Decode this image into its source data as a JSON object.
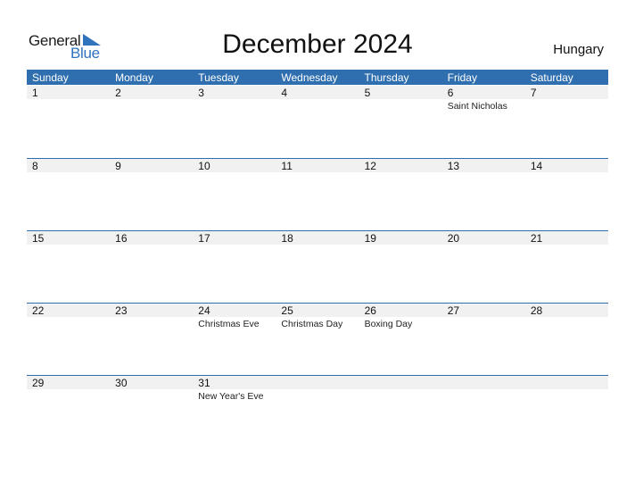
{
  "logo": {
    "text_general": "General",
    "text_blue": "Blue",
    "icon": "blue-triangle-flag-icon"
  },
  "title": "December 2024",
  "country": "Hungary",
  "colors": {
    "header_bg": "#2f6fb0",
    "accent_blue": "#2f74bd",
    "day_bar_bg": "#f1f1f1"
  },
  "weekdays": [
    "Sunday",
    "Monday",
    "Tuesday",
    "Wednesday",
    "Thursday",
    "Friday",
    "Saturday"
  ],
  "weeks": [
    [
      {
        "day": "1",
        "holiday": ""
      },
      {
        "day": "2",
        "holiday": ""
      },
      {
        "day": "3",
        "holiday": ""
      },
      {
        "day": "4",
        "holiday": ""
      },
      {
        "day": "5",
        "holiday": ""
      },
      {
        "day": "6",
        "holiday": "Saint Nicholas"
      },
      {
        "day": "7",
        "holiday": ""
      }
    ],
    [
      {
        "day": "8",
        "holiday": ""
      },
      {
        "day": "9",
        "holiday": ""
      },
      {
        "day": "10",
        "holiday": ""
      },
      {
        "day": "11",
        "holiday": ""
      },
      {
        "day": "12",
        "holiday": ""
      },
      {
        "day": "13",
        "holiday": ""
      },
      {
        "day": "14",
        "holiday": ""
      }
    ],
    [
      {
        "day": "15",
        "holiday": ""
      },
      {
        "day": "16",
        "holiday": ""
      },
      {
        "day": "17",
        "holiday": ""
      },
      {
        "day": "18",
        "holiday": ""
      },
      {
        "day": "19",
        "holiday": ""
      },
      {
        "day": "20",
        "holiday": ""
      },
      {
        "day": "21",
        "holiday": ""
      }
    ],
    [
      {
        "day": "22",
        "holiday": ""
      },
      {
        "day": "23",
        "holiday": ""
      },
      {
        "day": "24",
        "holiday": "Christmas Eve"
      },
      {
        "day": "25",
        "holiday": "Christmas Day"
      },
      {
        "day": "26",
        "holiday": "Boxing Day"
      },
      {
        "day": "27",
        "holiday": ""
      },
      {
        "day": "28",
        "holiday": ""
      }
    ],
    [
      {
        "day": "29",
        "holiday": ""
      },
      {
        "day": "30",
        "holiday": ""
      },
      {
        "day": "31",
        "holiday": "New Year's Eve"
      },
      {
        "day": "",
        "holiday": ""
      },
      {
        "day": "",
        "holiday": ""
      },
      {
        "day": "",
        "holiday": ""
      },
      {
        "day": "",
        "holiday": ""
      }
    ]
  ]
}
